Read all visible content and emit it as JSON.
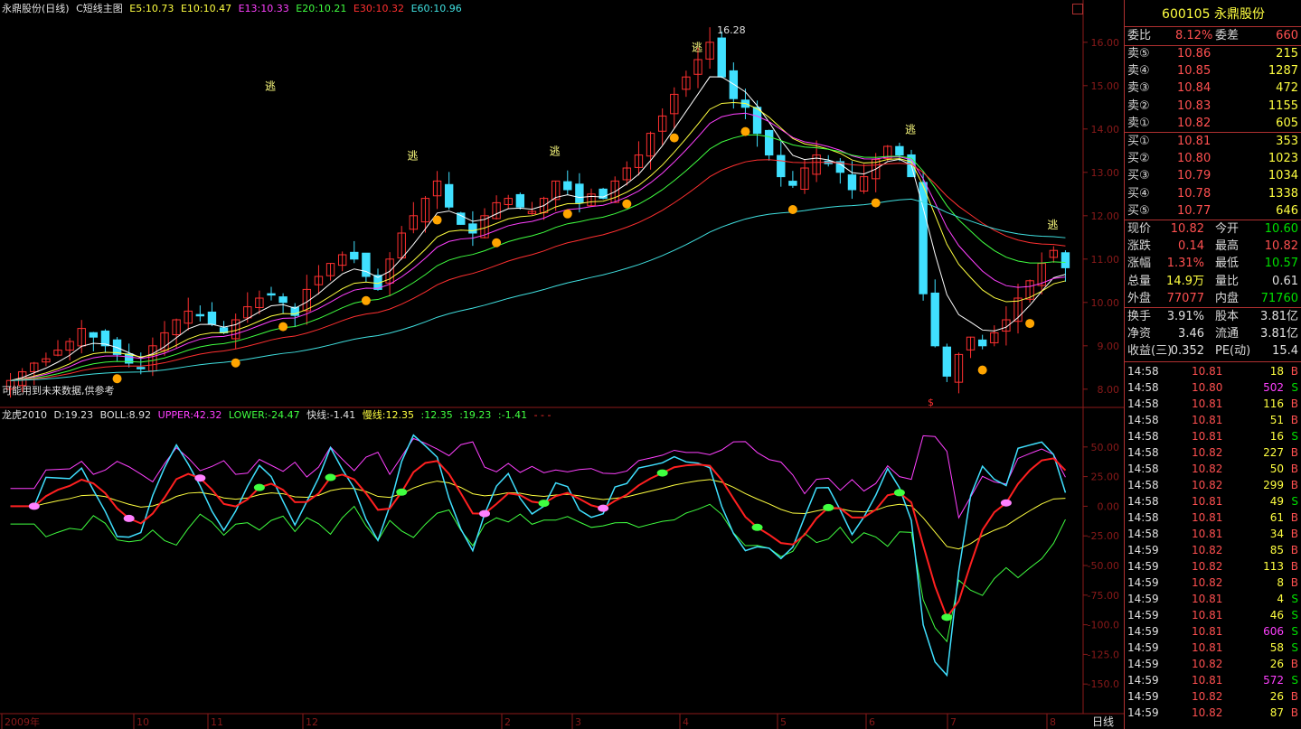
{
  "main_header": {
    "title": "永鼎股份(日线)",
    "indicator": "C短线主图",
    "e5": "E5:10.73",
    "e10": "E10:10.47",
    "e13": "E13:10.33",
    "e20": "E20:10.21",
    "e30": "E30:10.32",
    "e60": "E60:10.96"
  },
  "indicator_header": {
    "name": "龙虎2010",
    "d": "D:19.23",
    "boll": "BOLL:8.92",
    "upper": "UPPER:42.32",
    "lower": "LOWER:-24.47",
    "fast": "快线:-1.41",
    "slow": "慢线:12.35",
    "v1": ":12.35",
    "v2": ":19.23",
    "v3": ":-1.41",
    "v4": "- - -"
  },
  "warning": "可能用到未来数据,供参考",
  "peak_label": "16.28",
  "escape_marks": [
    "逃",
    "逃",
    "逃",
    "逃",
    "逃",
    "逃"
  ],
  "dollar_mark": "$",
  "price_axis": [
    "16.00",
    "15.00",
    "14.00",
    "13.00",
    "12.00",
    "11.00",
    "10.00",
    "9.00",
    "8.00"
  ],
  "indicator_axis": [
    "50.00",
    "25.00",
    "0.00",
    "-25.00",
    "-50.00",
    "-75.00",
    "-100.0",
    "-125.0",
    "-150.0"
  ],
  "time_axis": [
    "2009年",
    "10",
    "11",
    "12",
    "2",
    "3",
    "4",
    "5",
    "6",
    "7",
    "8"
  ],
  "period_label": "日线",
  "quote": {
    "code_name": "600105 永鼎股份",
    "weibi_label": "委比",
    "weibi": "8.12%",
    "weicha_label": "委差",
    "weicha": "660",
    "sells": [
      {
        "label": "卖⑤",
        "price": "10.86",
        "vol": "215"
      },
      {
        "label": "卖④",
        "price": "10.85",
        "vol": "1287"
      },
      {
        "label": "卖③",
        "price": "10.84",
        "vol": "472"
      },
      {
        "label": "卖②",
        "price": "10.83",
        "vol": "1155"
      },
      {
        "label": "卖①",
        "price": "10.82",
        "vol": "605"
      }
    ],
    "buys": [
      {
        "label": "买①",
        "price": "10.81",
        "vol": "353"
      },
      {
        "label": "买②",
        "price": "10.80",
        "vol": "1023"
      },
      {
        "label": "买③",
        "price": "10.79",
        "vol": "1034"
      },
      {
        "label": "买④",
        "price": "10.78",
        "vol": "1338"
      },
      {
        "label": "买⑤",
        "price": "10.77",
        "vol": "646"
      }
    ],
    "stats": [
      {
        "l1": "现价",
        "v1": "10.82",
        "c1": "red",
        "l2": "今开",
        "v2": "10.60",
        "c2": "grn"
      },
      {
        "l1": "涨跌",
        "v1": "0.14",
        "c1": "red",
        "l2": "最高",
        "v2": "10.82",
        "c2": "red"
      },
      {
        "l1": "涨幅",
        "v1": "1.31%",
        "c1": "red",
        "l2": "最低",
        "v2": "10.57",
        "c2": "grn"
      },
      {
        "l1": "总量",
        "v1": "14.9万",
        "c1": "yel",
        "l2": "量比",
        "v2": "0.61",
        "c2": "wht"
      },
      {
        "l1": "外盘",
        "v1": "77077",
        "c1": "red",
        "l2": "内盘",
        "v2": "71760",
        "c2": "grn"
      }
    ],
    "fundamentals": [
      {
        "l1": "换手",
        "v1": "3.91%",
        "l2": "股本",
        "v2": "3.81亿"
      },
      {
        "l1": "净资",
        "v1": "3.46",
        "l2": "流通",
        "v2": "3.81亿"
      },
      {
        "l1": "收益(三)",
        "v1": "0.352",
        "l2": "PE(动)",
        "v2": "15.4"
      }
    ]
  },
  "ticks": [
    {
      "t": "14:58",
      "p": "10.81",
      "v": "18",
      "s": "B",
      "vc": "yel",
      "pc": "red"
    },
    {
      "t": "14:58",
      "p": "10.80",
      "v": "502",
      "s": "S",
      "vc": "mag",
      "pc": "red"
    },
    {
      "t": "14:58",
      "p": "10.81",
      "v": "116",
      "s": "B",
      "vc": "yel",
      "pc": "red"
    },
    {
      "t": "14:58",
      "p": "10.81",
      "v": "51",
      "s": "B",
      "vc": "yel",
      "pc": "red"
    },
    {
      "t": "14:58",
      "p": "10.81",
      "v": "16",
      "s": "S",
      "vc": "yel",
      "pc": "red"
    },
    {
      "t": "14:58",
      "p": "10.82",
      "v": "227",
      "s": "B",
      "vc": "yel",
      "pc": "red"
    },
    {
      "t": "14:58",
      "p": "10.82",
      "v": "50",
      "s": "B",
      "vc": "yel",
      "pc": "red"
    },
    {
      "t": "14:58",
      "p": "10.82",
      "v": "299",
      "s": "B",
      "vc": "yel",
      "pc": "red"
    },
    {
      "t": "14:58",
      "p": "10.81",
      "v": "49",
      "s": "S",
      "vc": "yel",
      "pc": "red"
    },
    {
      "t": "14:58",
      "p": "10.81",
      "v": "61",
      "s": "B",
      "vc": "yel",
      "pc": "red"
    },
    {
      "t": "14:58",
      "p": "10.81",
      "v": "34",
      "s": "B",
      "vc": "yel",
      "pc": "red"
    },
    {
      "t": "14:59",
      "p": "10.82",
      "v": "85",
      "s": "B",
      "vc": "yel",
      "pc": "red"
    },
    {
      "t": "14:59",
      "p": "10.82",
      "v": "113",
      "s": "B",
      "vc": "yel",
      "pc": "red"
    },
    {
      "t": "14:59",
      "p": "10.82",
      "v": "8",
      "s": "B",
      "vc": "yel",
      "pc": "red"
    },
    {
      "t": "14:59",
      "p": "10.81",
      "v": "4",
      "s": "S",
      "vc": "yel",
      "pc": "red"
    },
    {
      "t": "14:59",
      "p": "10.81",
      "v": "46",
      "s": "S",
      "vc": "yel",
      "pc": "red"
    },
    {
      "t": "14:59",
      "p": "10.81",
      "v": "606",
      "s": "S",
      "vc": "mag",
      "pc": "red"
    },
    {
      "t": "14:59",
      "p": "10.81",
      "v": "58",
      "s": "S",
      "vc": "yel",
      "pc": "red"
    },
    {
      "t": "14:59",
      "p": "10.82",
      "v": "26",
      "s": "B",
      "vc": "yel",
      "pc": "red"
    },
    {
      "t": "14:59",
      "p": "10.81",
      "v": "572",
      "s": "S",
      "vc": "mag",
      "pc": "red"
    },
    {
      "t": "14:59",
      "p": "10.82",
      "v": "26",
      "s": "B",
      "vc": "yel",
      "pc": "red"
    },
    {
      "t": "14:59",
      "p": "10.82",
      "v": "87",
      "s": "B",
      "vc": "yel",
      "pc": "red"
    }
  ],
  "colors": {
    "up": "#ff3030",
    "down": "#40e0ff",
    "grid": "#8b1a1a",
    "e5": "#ffffff",
    "e10": "#ffff40",
    "e13": "#ff40ff",
    "e20": "#40ff40",
    "e30": "#ff3030",
    "e60": "#40e0e0"
  },
  "chart_data": {
    "type": "candlestick",
    "price_range": [
      7.6,
      16.6
    ],
    "indicator_range": [
      -175,
      75
    ],
    "closes": [
      8.2,
      8.4,
      8.6,
      8.7,
      8.9,
      9.1,
      9.4,
      9.2,
      9.0,
      8.8,
      8.6,
      8.5,
      9.0,
      9.3,
      9.6,
      9.8,
      9.7,
      9.5,
      9.3,
      9.6,
      9.9,
      10.1,
      10.2,
      10.0,
      9.7,
      10.3,
      10.6,
      10.9,
      11.1,
      11.0,
      10.6,
      10.3,
      11.0,
      11.6,
      12.0,
      12.4,
      12.8,
      12.2,
      11.8,
      11.6,
      12.0,
      12.3,
      12.4,
      12.2,
      12.1,
      12.4,
      12.8,
      12.6,
      12.3,
      12.5,
      12.4,
      12.8,
      13.1,
      13.4,
      13.9,
      14.3,
      14.8,
      15.2,
      15.6,
      16.0,
      15.2,
      14.7,
      14.5,
      13.9,
      13.4,
      12.9,
      12.7,
      13.1,
      13.4,
      13.2,
      13.0,
      12.6,
      12.9,
      13.3,
      13.6,
      13.4,
      12.9,
      10.2,
      9.0,
      8.3,
      8.8,
      9.2,
      9.0,
      9.3,
      9.6,
      10.1,
      10.5,
      10.9,
      11.2,
      10.8
    ]
  }
}
